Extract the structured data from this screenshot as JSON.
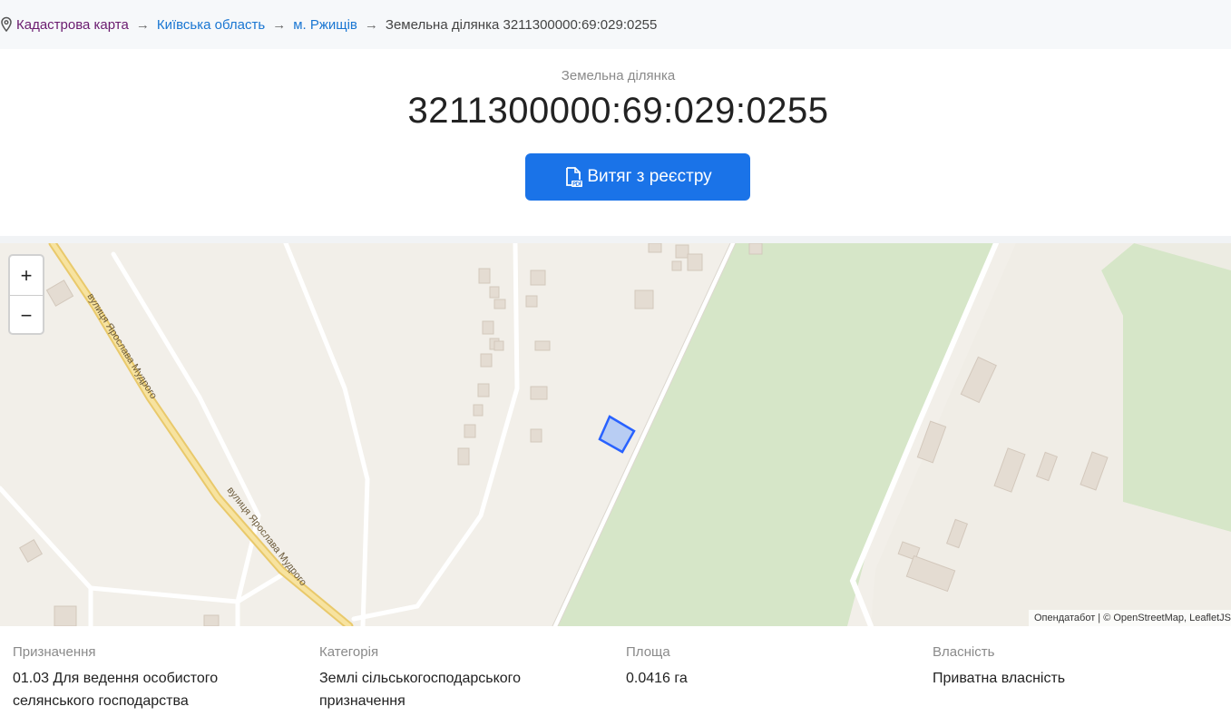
{
  "breadcrumb": {
    "root": "Кадастрова карта",
    "region": "Київська область",
    "city": "м. Ржищів",
    "current": "Земельна ділянка 3211300000:69:029:0255",
    "separator": "→"
  },
  "header": {
    "subtitle": "Земельна ділянка",
    "title": "3211300000:69:029:0255",
    "button_label": "Витяг з реєстру",
    "button_icon": "pdf-file-icon"
  },
  "map": {
    "zoom_in": "+",
    "zoom_out": "−",
    "road_label_1": "вулиця Ярослава Мудрого",
    "road_label_2": "вулиця Ярослава Мудрого",
    "attribution": "Опендатабот | © OpenStreetMap, LeafletJS"
  },
  "info": [
    {
      "label": "Призначення",
      "value": "01.03 Для ведення особистого селянського господарства"
    },
    {
      "label": "Категорія",
      "value": "Землі сільськогосподарського призначення"
    },
    {
      "label": "Площа",
      "value": "0.0416 га"
    },
    {
      "label": "Власність",
      "value": "Приватна власність"
    }
  ],
  "colors": {
    "accent": "#1a73e8",
    "root_link": "#6a1b6f",
    "link": "#1976d2",
    "forest": "#d6e6c8",
    "parcel": "#2962ff"
  }
}
